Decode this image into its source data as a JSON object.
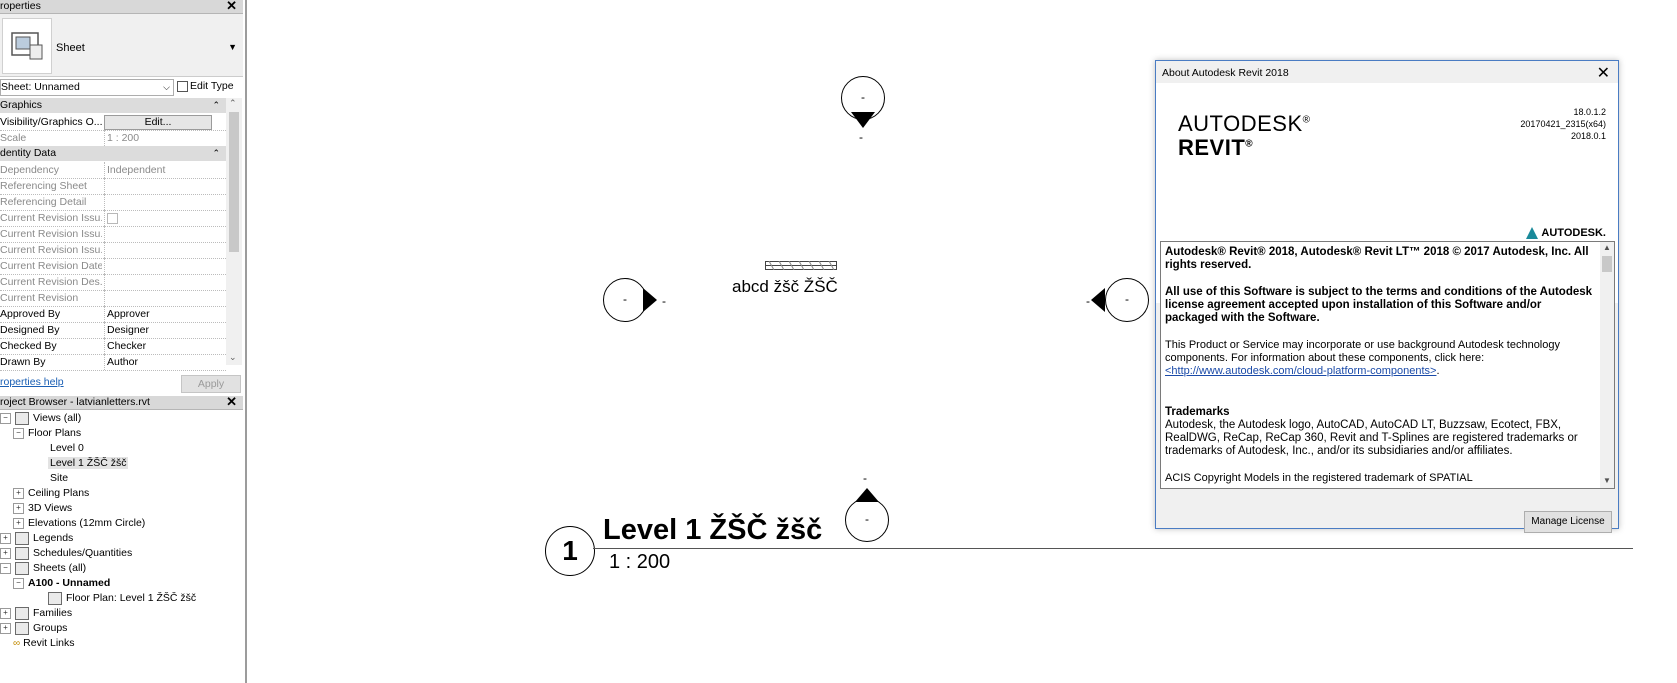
{
  "properties_panel": {
    "title": "roperties",
    "type_name": "Sheet",
    "instance_selector": "Sheet: Unnamed",
    "edit_type_label": "Edit Type",
    "groups": {
      "graphics": "Graphics",
      "identity": "dentity Data"
    },
    "rows": {
      "visibility": {
        "label": "Visibility/Graphics O...",
        "value": "Edit..."
      },
      "scale": {
        "label": "Scale",
        "value": "1 : 200"
      },
      "dependency": {
        "label": "Dependency",
        "value": "Independent"
      },
      "ref_sheet": {
        "label": "Referencing Sheet",
        "value": ""
      },
      "ref_detail": {
        "label": "Referencing Detail",
        "value": ""
      },
      "cri1": {
        "label": "Current Revision Issu...",
        "value": ""
      },
      "cri2": {
        "label": "Current Revision Issu...",
        "value": ""
      },
      "cri3": {
        "label": "Current Revision Issu...",
        "value": ""
      },
      "crd": {
        "label": "Current Revision Date",
        "value": ""
      },
      "crdesc": {
        "label": "Current Revision Des...",
        "value": ""
      },
      "cr": {
        "label": "Current Revision",
        "value": ""
      },
      "approved": {
        "label": "Approved By",
        "value": "Approver"
      },
      "designed": {
        "label": "Designed By",
        "value": "Designer"
      },
      "checked": {
        "label": "Checked By",
        "value": "Checker"
      },
      "drawn": {
        "label": "Drawn By",
        "value": "Author"
      }
    },
    "help_link": "roperties help",
    "apply_label": "Apply"
  },
  "project_browser": {
    "title": "roject Browser - latvianletters.rvt",
    "tree": {
      "views": "Views (all)",
      "floor_plans": "Floor Plans",
      "level0": "Level 0",
      "level1": "Level 1 ŽŠČ žšč",
      "site": "Site",
      "ceiling_plans": "Ceiling Plans",
      "views_3d": "3D Views",
      "elevations": "Elevations (12mm Circle)",
      "legends": "Legends",
      "schedules": "Schedules/Quantities",
      "sheets": "Sheets (all)",
      "a100": "A100 - Unnamed",
      "floor_plan_level1": "Floor Plan: Level 1 ŽŠČ žšč",
      "families": "Families",
      "groups": "Groups",
      "revit_links": "Revit Links"
    }
  },
  "canvas": {
    "marker_label": "-",
    "label_text": "abcd žšč  ŽŠČ",
    "view_number": "1",
    "view_title": "Level 1 ŽŠČ žšč",
    "view_scale": "1 : 200"
  },
  "about_dialog": {
    "title": "About Autodesk Revit 2018",
    "brand_line1": "AUTODESK",
    "brand_line2": "REVIT",
    "reg": "®",
    "version_1": "18.0.1.2",
    "version_2": "20170421_2315(x64)",
    "version_3": "2018.0.1",
    "autodesk_logo": "AUTODESK.",
    "para1": "Autodesk® Revit® 2018, Autodesk® Revit LT™ 2018 © 2017 Autodesk, Inc.  All rights reserved.",
    "para2": "All use of this Software is subject to the terms and conditions of the Autodesk license agreement accepted upon installation of this Software and/or packaged with the Software.",
    "para3": "This Product or Service may incorporate or use background Autodesk technology components.  For information about these components, click here:",
    "para3_link": "<http://www.autodesk.com/cloud-platform-components>",
    "trademarks_heading": "Trademarks",
    "trademarks_text": "Autodesk, the Autodesk logo, AutoCAD, AutoCAD LT, Buzzsaw, Ecotect, FBX, RealDWG, ReCap, ReCap 360, Revit and T-Splines are registered trademarks or trademarks of Autodesk, Inc., and/or its subsidiaries and/or affiliates.",
    "cut_line": "ACIS Copyright Models in the registered trademark of SPATIAL",
    "manage_license_label": "Manage License"
  }
}
